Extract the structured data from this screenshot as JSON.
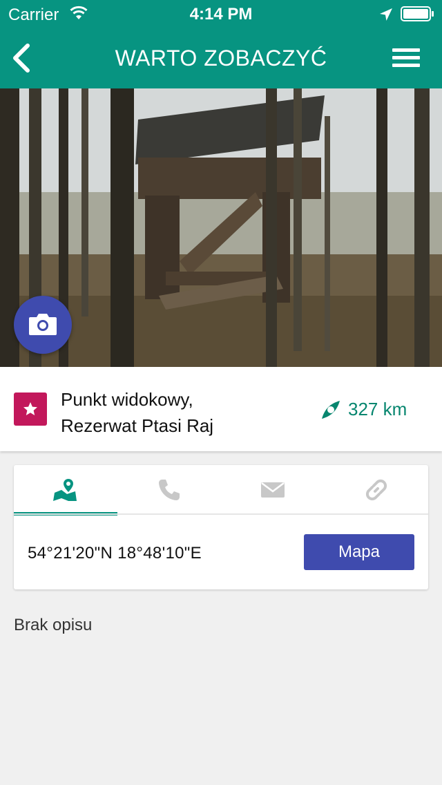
{
  "status_bar": {
    "carrier": "Carrier",
    "time": "4:14 PM",
    "icons": [
      "wifi-icon",
      "location-arrow-icon",
      "battery-icon"
    ]
  },
  "nav": {
    "title": "WARTO ZOBACZYĆ",
    "back_icon": "chevron-left-icon",
    "menu_icon": "hamburger-menu-icon"
  },
  "hero": {
    "image": "wooden bird observation tower among forest trees",
    "camera_icon": "camera-icon"
  },
  "place": {
    "category_icon": "star-icon",
    "name_line1": "Punkt widokowy,",
    "name_line2": "Rezerwat Ptasi Raj",
    "distance": "327 km",
    "distance_icon": "compass-icon"
  },
  "tabs": [
    {
      "icon": "map-pin-icon",
      "active": true
    },
    {
      "icon": "phone-icon",
      "active": false
    },
    {
      "icon": "mail-icon",
      "active": false
    },
    {
      "icon": "link-icon",
      "active": false
    }
  ],
  "location": {
    "coordinates": "54°21'20\"N 18°48'10\"E",
    "map_button": "Mapa"
  },
  "description": "Brak opisu",
  "colors": {
    "primary": "#079481",
    "accent": "#3f4bae",
    "category": "#c2185b",
    "background": "#f0f0f0"
  }
}
